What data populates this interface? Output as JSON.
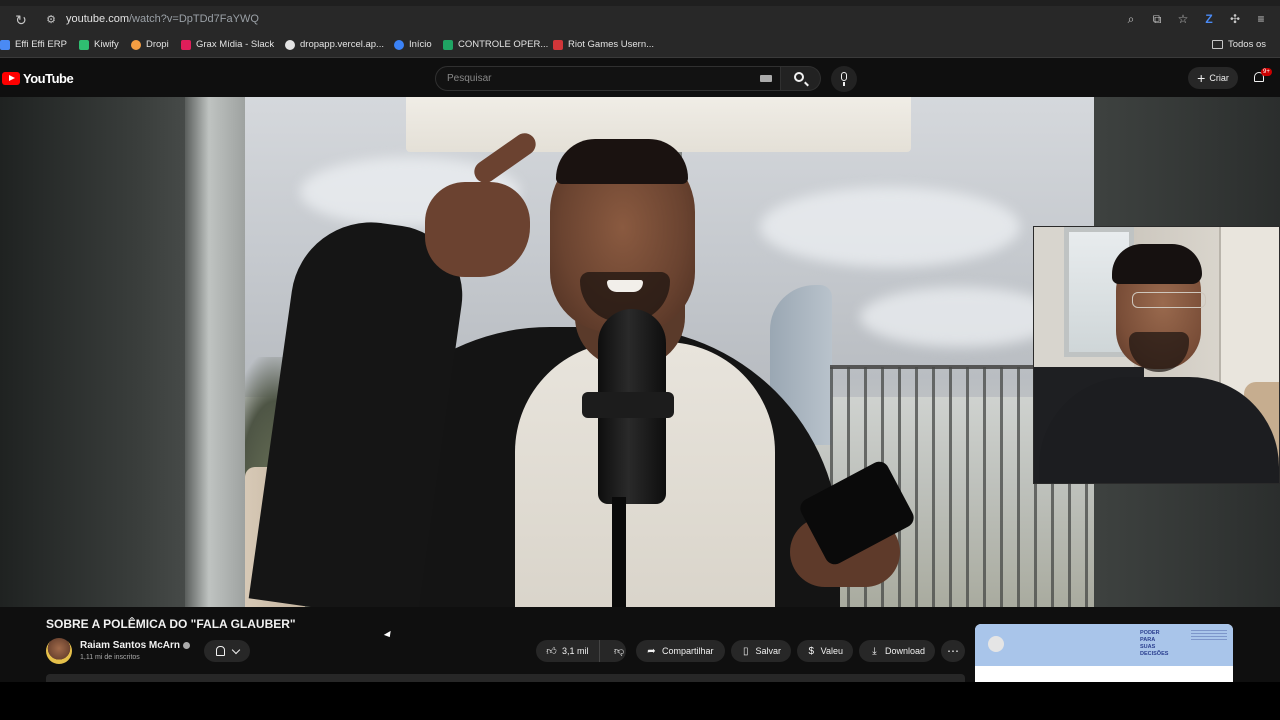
{
  "browser": {
    "url_domain": "youtube.com",
    "url_path": "/watch?v=DpTDd7FaYWQ",
    "bookmarks": [
      {
        "label": "Effi Effi ERP",
        "color": "#4a8af4"
      },
      {
        "label": "Kiwify",
        "color": "#2fbf71"
      },
      {
        "label": "Dropi",
        "color": "#f59e42"
      },
      {
        "label": "Grax Mídia - Slack",
        "color": "#e01e5a"
      },
      {
        "label": "dropapp.vercel.ap...",
        "color": "#e3e3e3"
      },
      {
        "label": "Início",
        "color": "#3b82f6"
      },
      {
        "label": "CONTROLE OPER...",
        "color": "#1fa463"
      },
      {
        "label": "Riot Games Usern...",
        "color": "#d13639"
      }
    ],
    "bookmarks_folder": "Todos os"
  },
  "youtube": {
    "logo_text": "YouTube",
    "search_placeholder": "Pesquisar",
    "create_label": "Criar",
    "notifications_badge": "9+"
  },
  "video": {
    "title": "SOBRE A POLÊMICA DO \"FALA GLAUBER\"",
    "channel_name": "Raiam Santos McArn",
    "subscribers": "1,11 mi de inscritos",
    "likes": "3,1 mil",
    "share_label": "Compartilhar",
    "save_label": "Salvar",
    "thanks_label": "Valeu",
    "download_label": "Download",
    "more_label": "⋯"
  },
  "ad": {
    "text": "PODER\nPARA\nSUAS\nDECISÕES"
  },
  "colors": {
    "brand_red": "#ff0000",
    "background": "#0f0f0f",
    "pill": "#272727"
  }
}
